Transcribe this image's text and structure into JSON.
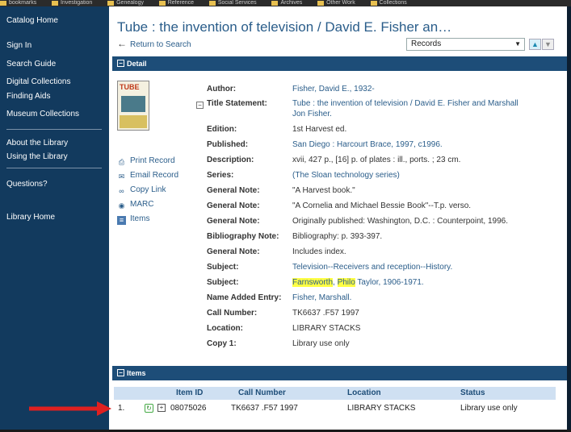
{
  "bookmarks": [
    "bookmarks",
    "Investigation",
    "Genealogy",
    "Reference",
    "Social Services",
    "Archives",
    "Other Work",
    "Collections"
  ],
  "sidebar": {
    "items": [
      {
        "label": "Catalog Home"
      },
      {
        "label": "Sign In"
      },
      {
        "label": "Search Guide"
      },
      {
        "label": "Digital Collections"
      },
      {
        "label": "Finding Aids"
      },
      {
        "label": "Museum Collections"
      },
      {
        "label": "About the Library"
      },
      {
        "label": "Using the Library"
      },
      {
        "label": "Questions?"
      },
      {
        "label": "Library Home"
      }
    ]
  },
  "header": {
    "title": "Tube : the invention of television / David E. Fisher an…",
    "back_label": "Return to Search",
    "records_select": "Records"
  },
  "detail": {
    "bar_label": "Detail",
    "cover_text": "TUBE",
    "actions": [
      {
        "label": "Print Record"
      },
      {
        "label": "Email Record"
      },
      {
        "label": "Copy Link"
      },
      {
        "label": "MARC"
      },
      {
        "label": "Items"
      }
    ],
    "fields": [
      {
        "label": "Author:",
        "value": "Fisher, David E., 1932-"
      },
      {
        "label": "Title Statement:",
        "value": "Tube : the invention of television / David E. Fisher and Marshall",
        "value2": "Jon Fisher."
      },
      {
        "label": "Edition:",
        "value": "1st Harvest ed."
      },
      {
        "label": "Published:",
        "value": "San Diego : Harcourt Brace, 1997, c1996."
      },
      {
        "label": "Description:",
        "value": "xvii, 427 p., [16] p. of plates : ill., ports. ; 23 cm."
      },
      {
        "label": "Series:",
        "value": "(The Sloan technology series)"
      },
      {
        "label": "General Note:",
        "value": "\"A Harvest book.\""
      },
      {
        "label": "General Note:",
        "value": "\"A Cornelia and Michael Bessie Book\"--T.p. verso."
      },
      {
        "label": "General Note:",
        "value": "Originally published: Washington, D.C. : Counterpoint, 1996."
      },
      {
        "label": "Bibliography Note:",
        "value": "Bibliography: p. 393-397."
      },
      {
        "label": "General Note:",
        "value": "Includes index."
      },
      {
        "label": "Subject:",
        "value": "Television--Receivers and reception--History."
      },
      {
        "label": "Subject:",
        "hl1": "Farnsworth",
        "hl2": "Philo",
        "rest": " Taylor, 1906-1971."
      },
      {
        "label": "Name Added Entry:",
        "value": "Fisher, Marshall."
      },
      {
        "label": "Call Number:",
        "value": "TK6637 .F57 1997"
      },
      {
        "label": "Location:",
        "value": "LIBRARY STACKS"
      },
      {
        "label": "Copy 1:",
        "value": "Library use only"
      }
    ]
  },
  "items": {
    "bar_label": "Items",
    "columns": [
      "Item ID",
      "Call Number",
      "Location",
      "Status"
    ],
    "rows": [
      {
        "num": "1.",
        "item_id": "08075026",
        "call_number": "TK6637 .F57 1997",
        "location": "LIBRARY STACKS",
        "status": "Library use only"
      }
    ]
  },
  "colors": {
    "sidebar": "#123a5e",
    "bar": "#1d4d78",
    "link": "#2a5d8a",
    "highlight": "#ffff44",
    "arrow": "#e02020"
  }
}
